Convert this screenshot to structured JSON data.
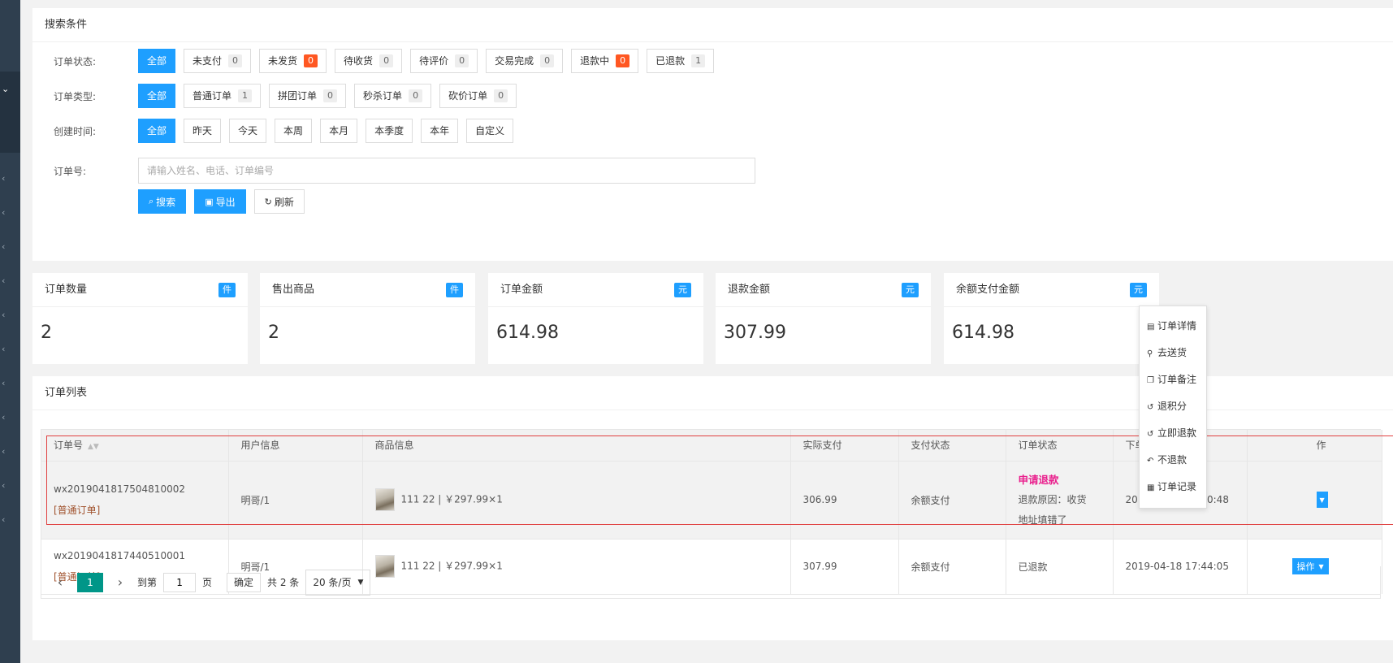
{
  "search": {
    "title": "搜索条件",
    "status_label": "订单状态:",
    "status_options": [
      {
        "label": "全部",
        "count": "",
        "active": true
      },
      {
        "label": "未支付",
        "count": "0"
      },
      {
        "label": "未发货",
        "count": "0",
        "hot": true
      },
      {
        "label": "待收货",
        "count": "0"
      },
      {
        "label": "待评价",
        "count": "0"
      },
      {
        "label": "交易完成",
        "count": "0"
      },
      {
        "label": "退款中",
        "count": "0",
        "hot": true
      },
      {
        "label": "已退款",
        "count": "1"
      }
    ],
    "type_label": "订单类型:",
    "type_options": [
      {
        "label": "全部",
        "count": "",
        "active": true
      },
      {
        "label": "普通订单",
        "count": "1"
      },
      {
        "label": "拼团订单",
        "count": "0"
      },
      {
        "label": "秒杀订单",
        "count": "0"
      },
      {
        "label": "砍价订单",
        "count": "0"
      }
    ],
    "time_label": "创建时间:",
    "time_options": [
      "全部",
      "昨天",
      "今天",
      "本周",
      "本月",
      "本季度",
      "本年",
      "自定义"
    ],
    "order_no_label": "订单号:",
    "order_no_placeholder": "请输入姓名、电话、订单编号",
    "search_btn": "搜索",
    "export_btn": "导出",
    "refresh_btn": "刷新"
  },
  "stats": [
    {
      "title": "订单数量",
      "unit": "件",
      "value": "2"
    },
    {
      "title": "售出商品",
      "unit": "件",
      "value": "2"
    },
    {
      "title": "订单金额",
      "unit": "元",
      "value": "614.98"
    },
    {
      "title": "退款金额",
      "unit": "元",
      "value": "307.99"
    },
    {
      "title": "余额支付金额",
      "unit": "元",
      "value": "614.98"
    }
  ],
  "orders": {
    "title": "订单列表",
    "columns": [
      "订单号",
      "用户信息",
      "商品信息",
      "实际支付",
      "支付状态",
      "订单状态",
      "下单时间",
      "操作"
    ],
    "rows": [
      {
        "order_no": "wx2019041817504810002",
        "order_type": "[普通订单]",
        "user": "明哥/1",
        "product": "111 22 | ￥297.99×1",
        "paid": "306.99",
        "pay_status": "余额支付",
        "status": "申请退款",
        "reason_line1": "退款原因：收货",
        "reason_line2": "地址填错了",
        "time": "2019-04-18 17:50:48"
      },
      {
        "order_no": "wx2019041817440510001",
        "order_type": "[普通订单]",
        "user": "明哥/1",
        "product": "111 22 | ￥297.99×1",
        "paid": "307.99",
        "pay_status": "余额支付",
        "status": "已退款",
        "time": "2019-04-18 17:44:05",
        "op_label": "操作"
      }
    ]
  },
  "pagination": {
    "current": "1",
    "goto_label": "到第",
    "goto_value": "1",
    "page_label": "页",
    "confirm": "确定",
    "total": "共 2 条",
    "page_size": "20 条/页"
  },
  "dropdown": {
    "items": [
      {
        "label": "订单详情",
        "icon": "file-icon"
      },
      {
        "label": "去送货",
        "icon": "motorcycle-icon"
      },
      {
        "label": "订单备注",
        "icon": "copy-icon"
      },
      {
        "label": "退积分",
        "icon": "history-icon"
      },
      {
        "label": "立即退款",
        "icon": "history-icon"
      },
      {
        "label": "不退款",
        "icon": "undo-icon"
      },
      {
        "label": "订单记录",
        "icon": "list-icon"
      }
    ]
  },
  "colors": {
    "primary": "#1e9fff",
    "hot_badge": "#ff5722",
    "pager_active": "#009688",
    "refund_status": "#e91e8c"
  }
}
